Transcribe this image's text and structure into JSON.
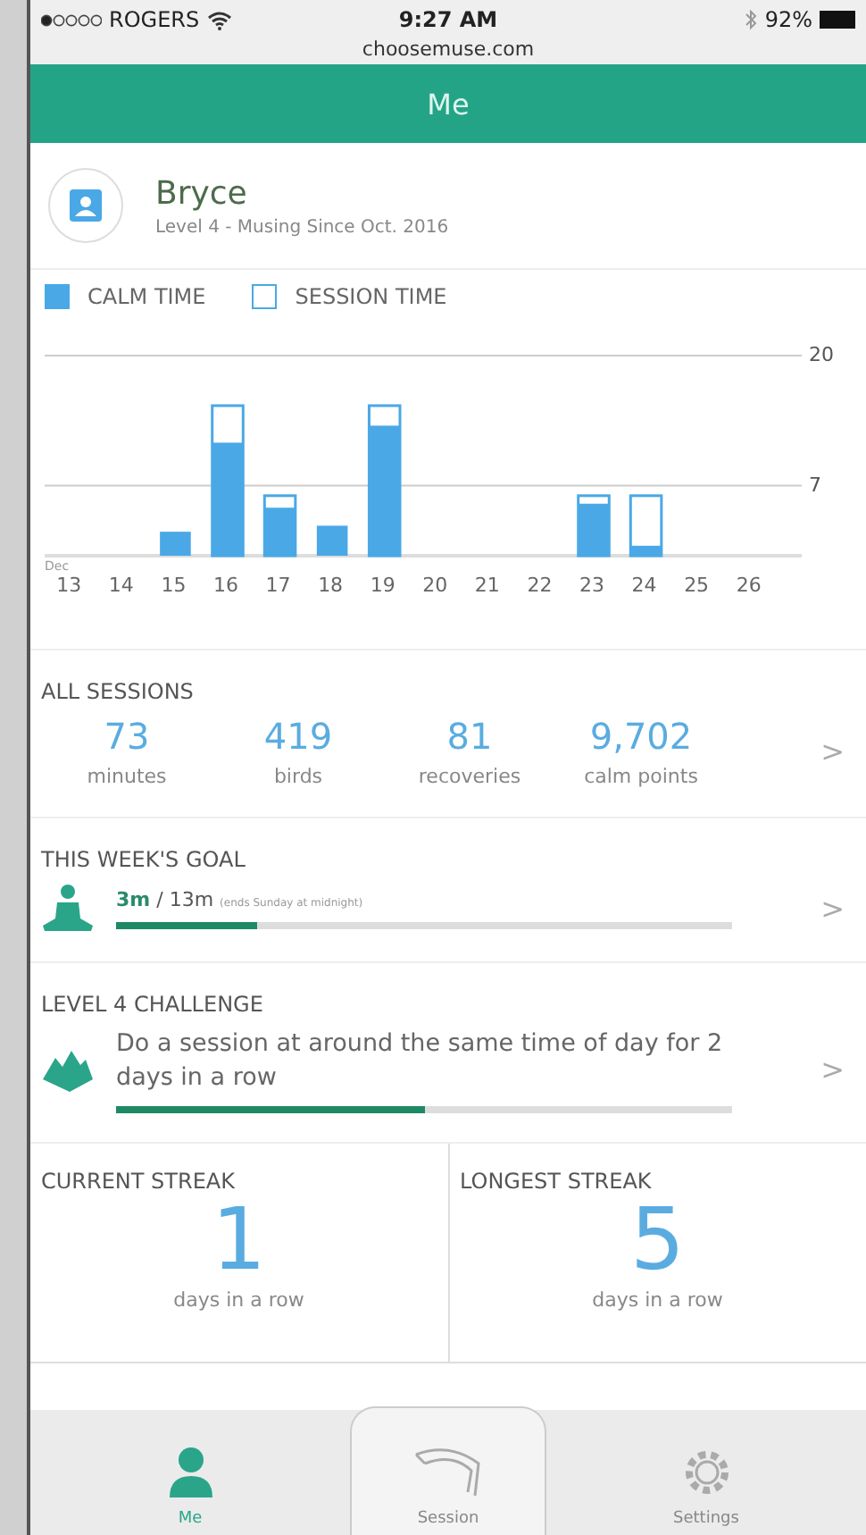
{
  "status_bar": {
    "carrier": "ROGERS",
    "time": "9:27 AM",
    "battery": "92%",
    "url": "choosemuse.com"
  },
  "header": {
    "title": "Me"
  },
  "profile": {
    "name": "Bryce",
    "subtitle": "Level 4 - Musing Since Oct. 2016"
  },
  "chart": {
    "month_label": "Dec",
    "chart_data": {
      "type": "bar",
      "legend": "top",
      "categories": [
        "13",
        "14",
        "15",
        "16",
        "17",
        "18",
        "19",
        "20",
        "21",
        "22",
        "23",
        "24",
        "25",
        "26"
      ],
      "ylim": [
        0,
        20
      ],
      "yticks": [
        {
          "value": 7,
          "label": "7"
        },
        {
          "value": 20,
          "label": "20"
        }
      ],
      "series": [
        {
          "name": "CALM TIME",
          "color": "#4aa8e6",
          "values": [
            0,
            0,
            2.4,
            11.3,
            4.8,
            3,
            13,
            0,
            0,
            0,
            5.2,
            1,
            0,
            0
          ]
        },
        {
          "name": "SESSION TIME",
          "color": "#4aa8e6",
          "values": [
            0,
            0,
            null,
            15,
            6,
            null,
            15,
            0,
            0,
            0,
            6,
            6,
            0,
            0
          ]
        }
      ]
    }
  },
  "all_sessions": {
    "title": "ALL SESSIONS",
    "stats": [
      {
        "value": "73",
        "label": "minutes"
      },
      {
        "value": "419",
        "label": "birds"
      },
      {
        "value": "81",
        "label": "recoveries"
      },
      {
        "value": "9,702",
        "label": "calm points"
      }
    ],
    "chevron": ">"
  },
  "goal": {
    "title": "THIS WEEK'S GOAL",
    "progress": "**3m** / 13m",
    "note": "(ends Sunday at midnight)",
    "level": 0.23,
    "chevron": ">"
  },
  "challenge": {
    "title": "LEVEL 4 CHALLENGE",
    "text": "Do a session at around the same time of day for 2 days in a row",
    "level": 0.5,
    "chevron": ">"
  },
  "streaks": [
    {
      "title": "CURRENT STREAK",
      "value": "1",
      "label": "days in a row"
    },
    {
      "title": "LONGEST STREAK",
      "value": "5",
      "label": "days in a row"
    }
  ],
  "tabs": [
    {
      "label": "Me",
      "kind": "me",
      "selected": true
    },
    {
      "label": "Session",
      "kind": "session",
      "selected": false
    },
    {
      "label": "Settings",
      "kind": "settings",
      "selected": false
    }
  ]
}
